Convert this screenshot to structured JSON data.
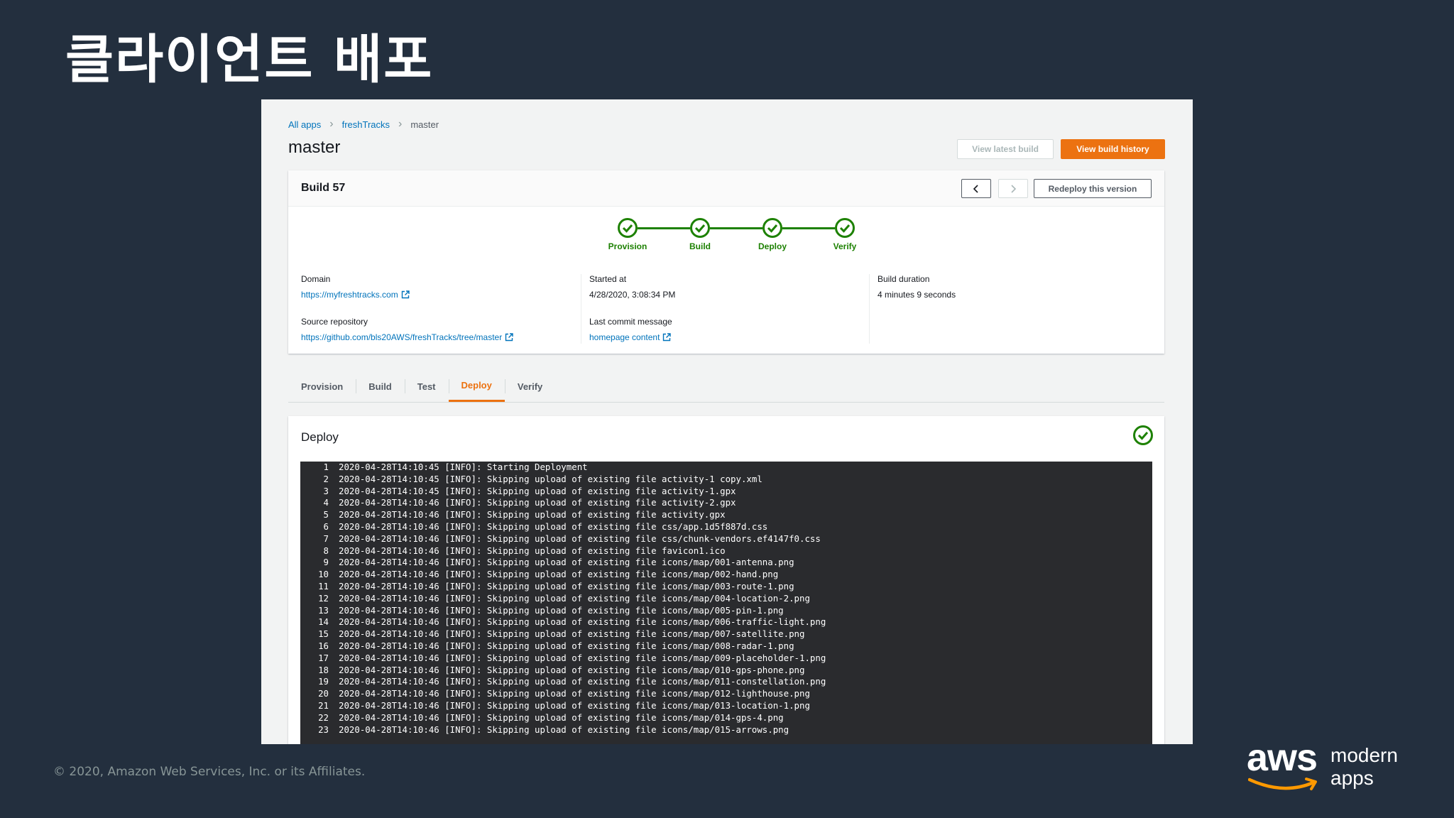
{
  "slide": {
    "title": "클라이언트 배포",
    "copyright": "© 2020, Amazon Web Services, Inc. or its Affiliates.",
    "brand": "aws",
    "brand_line1": "modern",
    "brand_line2": "apps"
  },
  "breadcrumb": {
    "item1": "All apps",
    "item2": "freshTracks",
    "item3": "master"
  },
  "page_title": "master",
  "actions": {
    "view_latest": "View latest build",
    "view_history": "View build history"
  },
  "build": {
    "title": "Build 57",
    "redeploy": "Redeploy this version",
    "steps": [
      "Provision",
      "Build",
      "Deploy",
      "Verify"
    ],
    "domain_label": "Domain",
    "domain_value": "https://myfreshtracks.com",
    "repo_label": "Source repository",
    "repo_value": "https://github.com/bls20AWS/freshTracks/tree/master",
    "started_label": "Started at",
    "started_value": "4/28/2020, 3:08:34 PM",
    "commit_label": "Last commit message",
    "commit_value": "homepage content",
    "duration_label": "Build duration",
    "duration_value": "4 minutes 9 seconds"
  },
  "tabs": [
    "Provision",
    "Build",
    "Test",
    "Deploy",
    "Verify"
  ],
  "active_tab": "Deploy",
  "deploy": {
    "title": "Deploy",
    "log": [
      "2020-04-28T14:10:45 [INFO]: Starting Deployment",
      "2020-04-28T14:10:45 [INFO]: Skipping upload of existing file activity-1 copy.xml",
      "2020-04-28T14:10:45 [INFO]: Skipping upload of existing file activity-1.gpx",
      "2020-04-28T14:10:46 [INFO]: Skipping upload of existing file activity-2.gpx",
      "2020-04-28T14:10:46 [INFO]: Skipping upload of existing file activity.gpx",
      "2020-04-28T14:10:46 [INFO]: Skipping upload of existing file css/app.1d5f887d.css",
      "2020-04-28T14:10:46 [INFO]: Skipping upload of existing file css/chunk-vendors.ef4147f0.css",
      "2020-04-28T14:10:46 [INFO]: Skipping upload of existing file favicon1.ico",
      "2020-04-28T14:10:46 [INFO]: Skipping upload of existing file icons/map/001-antenna.png",
      "2020-04-28T14:10:46 [INFO]: Skipping upload of existing file icons/map/002-hand.png",
      "2020-04-28T14:10:46 [INFO]: Skipping upload of existing file icons/map/003-route-1.png",
      "2020-04-28T14:10:46 [INFO]: Skipping upload of existing file icons/map/004-location-2.png",
      "2020-04-28T14:10:46 [INFO]: Skipping upload of existing file icons/map/005-pin-1.png",
      "2020-04-28T14:10:46 [INFO]: Skipping upload of existing file icons/map/006-traffic-light.png",
      "2020-04-28T14:10:46 [INFO]: Skipping upload of existing file icons/map/007-satellite.png",
      "2020-04-28T14:10:46 [INFO]: Skipping upload of existing file icons/map/008-radar-1.png",
      "2020-04-28T14:10:46 [INFO]: Skipping upload of existing file icons/map/009-placeholder-1.png",
      "2020-04-28T14:10:46 [INFO]: Skipping upload of existing file icons/map/010-gps-phone.png",
      "2020-04-28T14:10:46 [INFO]: Skipping upload of existing file icons/map/011-constellation.png",
      "2020-04-28T14:10:46 [INFO]: Skipping upload of existing file icons/map/012-lighthouse.png",
      "2020-04-28T14:10:46 [INFO]: Skipping upload of existing file icons/map/013-location-1.png",
      "2020-04-28T14:10:46 [INFO]: Skipping upload of existing file icons/map/014-gps-4.png",
      "2020-04-28T14:10:46 [INFO]: Skipping upload of existing file icons/map/015-arrows.png"
    ]
  },
  "colors": {
    "background": "#232f3e",
    "accent": "#ec7211",
    "success": "#1d8102",
    "link": "#0073bb"
  },
  "icons": [
    "check-circle-icon",
    "external-link-icon",
    "chevron-left-icon",
    "chevron-right-icon",
    "aws-smile-icon"
  ]
}
